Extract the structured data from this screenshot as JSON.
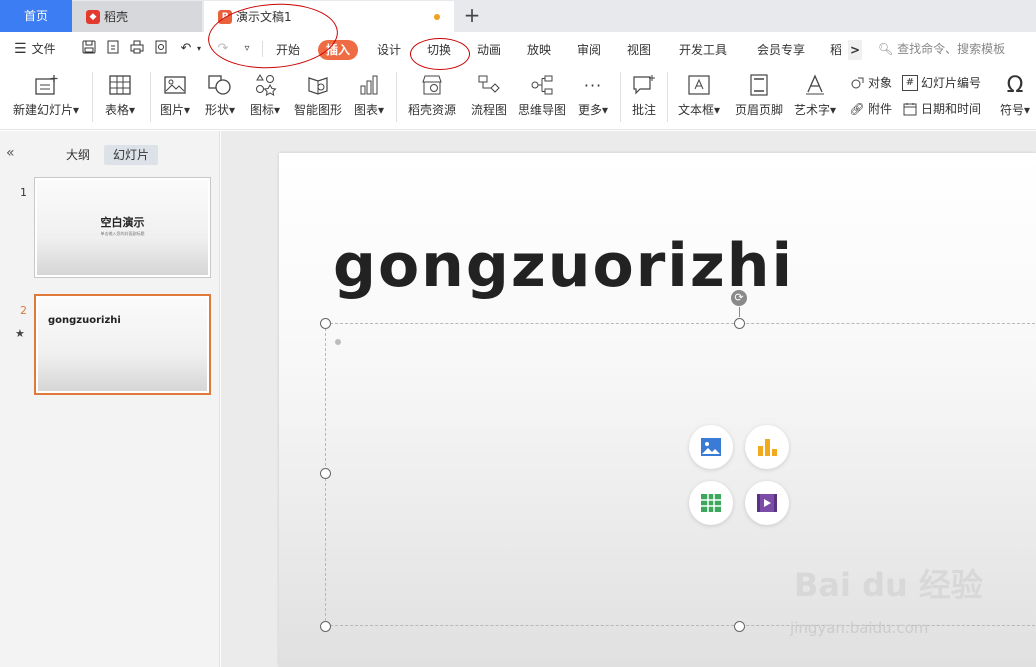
{
  "tabs": {
    "home": "首页",
    "docer": "稻壳",
    "document": "演示文稿1",
    "add": "+"
  },
  "menu": {
    "file": "文件",
    "items": [
      "开始",
      "插入",
      "设计",
      "切换",
      "动画",
      "放映",
      "审阅",
      "视图",
      "开发工具",
      "会员专享",
      "稻壳"
    ],
    "more": ">",
    "search_placeholder": "查找命令、搜索模板"
  },
  "ribbon": {
    "new_slide": "新建幻灯片",
    "table": "表格",
    "picture": "图片",
    "shape": "形状",
    "icon": "图标",
    "smart_art": "智能图形",
    "chart": "图表",
    "docer_res": "稻壳资源",
    "flowchart": "流程图",
    "mindmap": "思维导图",
    "more": "更多",
    "comment": "批注",
    "textbox": "文本框",
    "header_footer": "页眉页脚",
    "wordart": "艺术字",
    "object": "对象",
    "attachment": "附件",
    "slide_number": "幻灯片编号",
    "date_time": "日期和时间",
    "symbol": "符号"
  },
  "pane": {
    "tab_outline": "大纲",
    "tab_slides": "幻灯片",
    "slides": [
      {
        "num": "1",
        "title": "空白演示",
        "subtitle": "单击输入您的封面副标题"
      },
      {
        "num": "2",
        "title": "gongzuorizhi"
      }
    ]
  },
  "slide": {
    "title": "gongzuorizhi"
  },
  "watermark": {
    "brand": "Bai du 经验",
    "url": "jingyan.baidu.com"
  },
  "colors": {
    "accent": "#ee6b43",
    "home_tab": "#3d7df4",
    "selected_thumb": "#e07a3c"
  }
}
